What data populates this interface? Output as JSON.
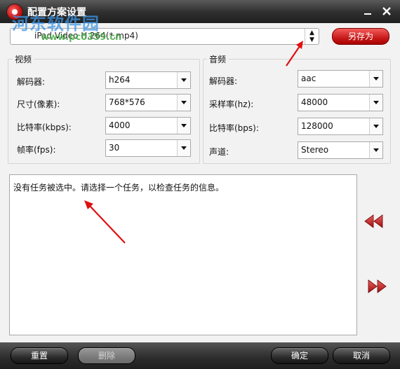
{
  "window": {
    "title": "配置方案设置",
    "watermark_name": "河东软件园",
    "watermark_url": "www.pc0359.cn"
  },
  "titlebar_buttons": {
    "minimize_icon": "minimize-icon",
    "close_icon": "close-icon"
  },
  "preset": {
    "value": "iPad Video H.264(*.mp4)",
    "save_as_label": "另存为"
  },
  "video": {
    "group_label": "视频",
    "fields": [
      {
        "label": "解码器:",
        "value": "h264"
      },
      {
        "label": "尺寸(像素):",
        "value": "768*576"
      },
      {
        "label": "比特率(kbps):",
        "value": "4000"
      },
      {
        "label": "帧率(fps):",
        "value": "30"
      }
    ]
  },
  "audio": {
    "group_label": "音频",
    "fields": [
      {
        "label": "解码器:",
        "value": "aac"
      },
      {
        "label": "采样率(hz):",
        "value": "48000"
      },
      {
        "label": "比特率(bps):",
        "value": "128000"
      },
      {
        "label": "声道:",
        "value": "Stereo"
      }
    ]
  },
  "info": {
    "text": "没有任务被选中。请选择一个任务，以检查任务的信息。"
  },
  "nav": {
    "prev_icon": "double-left-arrow-icon",
    "next_icon": "double-right-arrow-icon"
  },
  "footer": {
    "reset_label": "重置",
    "delete_label": "删除",
    "ok_label": "确定",
    "cancel_label": "取消"
  },
  "colors": {
    "accent_red": "#c71b1b",
    "annotation_arrow": "#e01010",
    "titlebar": "#2e2e2e"
  }
}
